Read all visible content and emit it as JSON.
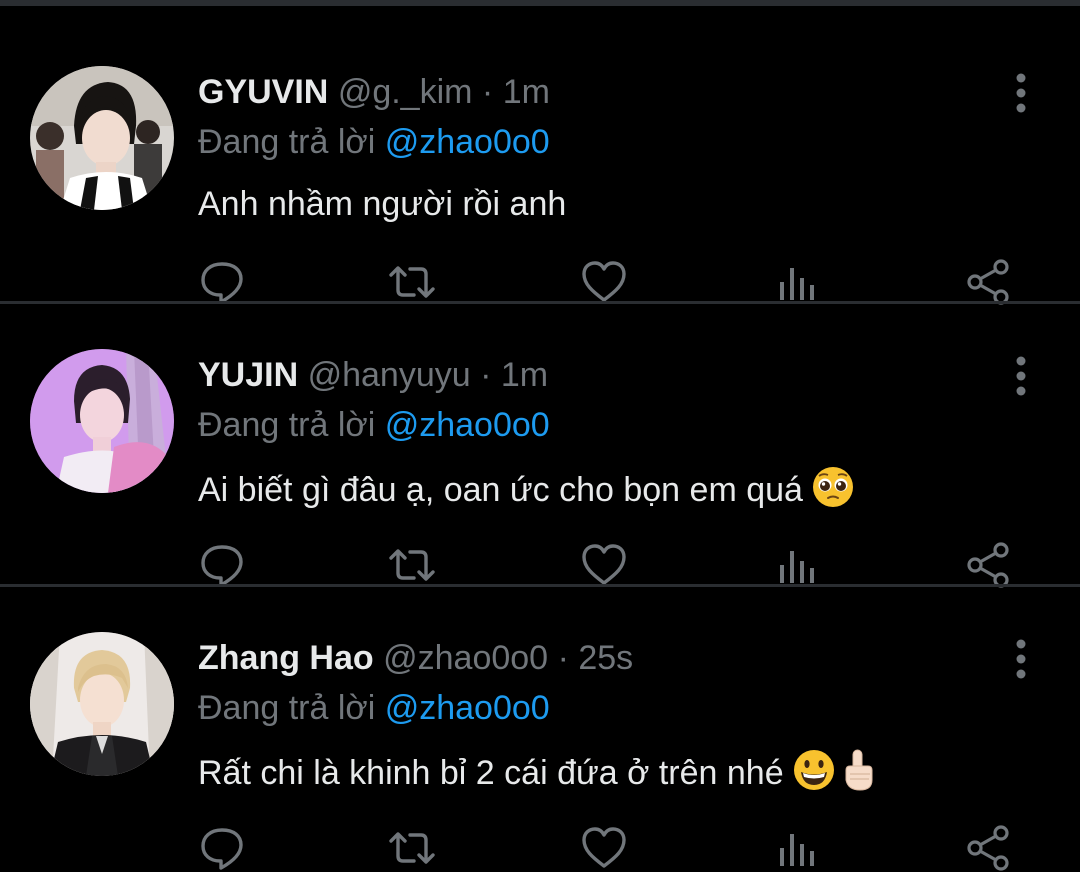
{
  "theme": {
    "background": "#000000",
    "divider": "#2a2d31",
    "text": "#e7e9ea",
    "muted": "#71767b",
    "link": "#1d9bf0"
  },
  "tweets": [
    {
      "name": "GYUVIN",
      "handle": "@g._kim",
      "separator": "·",
      "time": "1m",
      "replying_prefix": "Đang trả lời",
      "replying_to": "@zhao0o0",
      "text": "Anh nhầm người rồi anh",
      "emoji": [],
      "avatar_icon": "profile-photo"
    },
    {
      "name": "YUJIN",
      "handle": "@hanyuyu",
      "separator": "·",
      "time": "1m",
      "replying_prefix": "Đang trả lời",
      "replying_to": "@zhao0o0",
      "text": "Ai biết gì đâu ạ, oan ức cho bọn em quá",
      "emoji": [
        "pleading-face-emoji"
      ],
      "avatar_icon": "profile-photo"
    },
    {
      "name": "Zhang Hao",
      "handle": "@zhao0o0",
      "separator": "·",
      "time": "25s",
      "replying_prefix": "Đang trả lời",
      "replying_to": "@zhao0o0",
      "text": "Rất chi là khinh bỉ 2 cái đứa ở trên nhé",
      "emoji": [
        "grinning-face-emoji",
        "pointing-up-emoji"
      ],
      "avatar_icon": "profile-photo"
    }
  ],
  "action_icons": [
    "reply-icon",
    "retweet-icon",
    "like-icon",
    "analytics-icon",
    "share-icon"
  ]
}
